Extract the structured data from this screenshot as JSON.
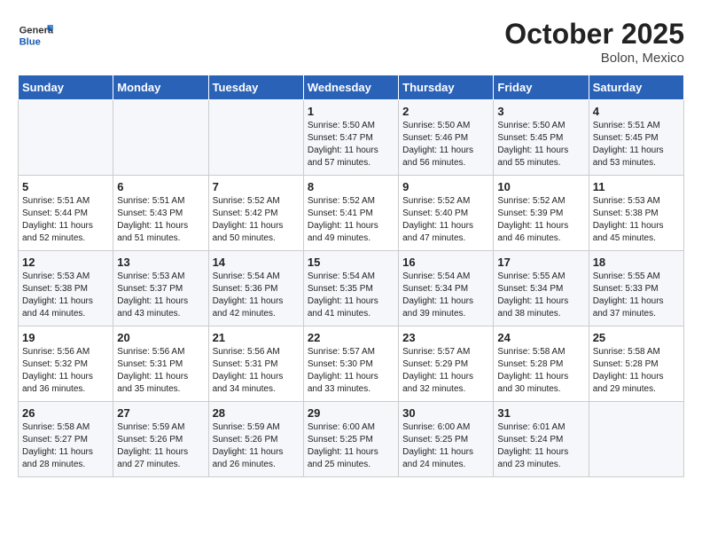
{
  "logo": {
    "general": "General",
    "blue": "Blue"
  },
  "title": "October 2025",
  "subtitle": "Bolon, Mexico",
  "days_of_week": [
    "Sunday",
    "Monday",
    "Tuesday",
    "Wednesday",
    "Thursday",
    "Friday",
    "Saturday"
  ],
  "weeks": [
    [
      {
        "day": "",
        "content": ""
      },
      {
        "day": "",
        "content": ""
      },
      {
        "day": "",
        "content": ""
      },
      {
        "day": "1",
        "content": "Sunrise: 5:50 AM\nSunset: 5:47 PM\nDaylight: 11 hours and 57 minutes."
      },
      {
        "day": "2",
        "content": "Sunrise: 5:50 AM\nSunset: 5:46 PM\nDaylight: 11 hours and 56 minutes."
      },
      {
        "day": "3",
        "content": "Sunrise: 5:50 AM\nSunset: 5:45 PM\nDaylight: 11 hours and 55 minutes."
      },
      {
        "day": "4",
        "content": "Sunrise: 5:51 AM\nSunset: 5:45 PM\nDaylight: 11 hours and 53 minutes."
      }
    ],
    [
      {
        "day": "5",
        "content": "Sunrise: 5:51 AM\nSunset: 5:44 PM\nDaylight: 11 hours and 52 minutes."
      },
      {
        "day": "6",
        "content": "Sunrise: 5:51 AM\nSunset: 5:43 PM\nDaylight: 11 hours and 51 minutes."
      },
      {
        "day": "7",
        "content": "Sunrise: 5:52 AM\nSunset: 5:42 PM\nDaylight: 11 hours and 50 minutes."
      },
      {
        "day": "8",
        "content": "Sunrise: 5:52 AM\nSunset: 5:41 PM\nDaylight: 11 hours and 49 minutes."
      },
      {
        "day": "9",
        "content": "Sunrise: 5:52 AM\nSunset: 5:40 PM\nDaylight: 11 hours and 47 minutes."
      },
      {
        "day": "10",
        "content": "Sunrise: 5:52 AM\nSunset: 5:39 PM\nDaylight: 11 hours and 46 minutes."
      },
      {
        "day": "11",
        "content": "Sunrise: 5:53 AM\nSunset: 5:38 PM\nDaylight: 11 hours and 45 minutes."
      }
    ],
    [
      {
        "day": "12",
        "content": "Sunrise: 5:53 AM\nSunset: 5:38 PM\nDaylight: 11 hours and 44 minutes."
      },
      {
        "day": "13",
        "content": "Sunrise: 5:53 AM\nSunset: 5:37 PM\nDaylight: 11 hours and 43 minutes."
      },
      {
        "day": "14",
        "content": "Sunrise: 5:54 AM\nSunset: 5:36 PM\nDaylight: 11 hours and 42 minutes."
      },
      {
        "day": "15",
        "content": "Sunrise: 5:54 AM\nSunset: 5:35 PM\nDaylight: 11 hours and 41 minutes."
      },
      {
        "day": "16",
        "content": "Sunrise: 5:54 AM\nSunset: 5:34 PM\nDaylight: 11 hours and 39 minutes."
      },
      {
        "day": "17",
        "content": "Sunrise: 5:55 AM\nSunset: 5:34 PM\nDaylight: 11 hours and 38 minutes."
      },
      {
        "day": "18",
        "content": "Sunrise: 5:55 AM\nSunset: 5:33 PM\nDaylight: 11 hours and 37 minutes."
      }
    ],
    [
      {
        "day": "19",
        "content": "Sunrise: 5:56 AM\nSunset: 5:32 PM\nDaylight: 11 hours and 36 minutes."
      },
      {
        "day": "20",
        "content": "Sunrise: 5:56 AM\nSunset: 5:31 PM\nDaylight: 11 hours and 35 minutes."
      },
      {
        "day": "21",
        "content": "Sunrise: 5:56 AM\nSunset: 5:31 PM\nDaylight: 11 hours and 34 minutes."
      },
      {
        "day": "22",
        "content": "Sunrise: 5:57 AM\nSunset: 5:30 PM\nDaylight: 11 hours and 33 minutes."
      },
      {
        "day": "23",
        "content": "Sunrise: 5:57 AM\nSunset: 5:29 PM\nDaylight: 11 hours and 32 minutes."
      },
      {
        "day": "24",
        "content": "Sunrise: 5:58 AM\nSunset: 5:28 PM\nDaylight: 11 hours and 30 minutes."
      },
      {
        "day": "25",
        "content": "Sunrise: 5:58 AM\nSunset: 5:28 PM\nDaylight: 11 hours and 29 minutes."
      }
    ],
    [
      {
        "day": "26",
        "content": "Sunrise: 5:58 AM\nSunset: 5:27 PM\nDaylight: 11 hours and 28 minutes."
      },
      {
        "day": "27",
        "content": "Sunrise: 5:59 AM\nSunset: 5:26 PM\nDaylight: 11 hours and 27 minutes."
      },
      {
        "day": "28",
        "content": "Sunrise: 5:59 AM\nSunset: 5:26 PM\nDaylight: 11 hours and 26 minutes."
      },
      {
        "day": "29",
        "content": "Sunrise: 6:00 AM\nSunset: 5:25 PM\nDaylight: 11 hours and 25 minutes."
      },
      {
        "day": "30",
        "content": "Sunrise: 6:00 AM\nSunset: 5:25 PM\nDaylight: 11 hours and 24 minutes."
      },
      {
        "day": "31",
        "content": "Sunrise: 6:01 AM\nSunset: 5:24 PM\nDaylight: 11 hours and 23 minutes."
      },
      {
        "day": "",
        "content": ""
      }
    ]
  ]
}
